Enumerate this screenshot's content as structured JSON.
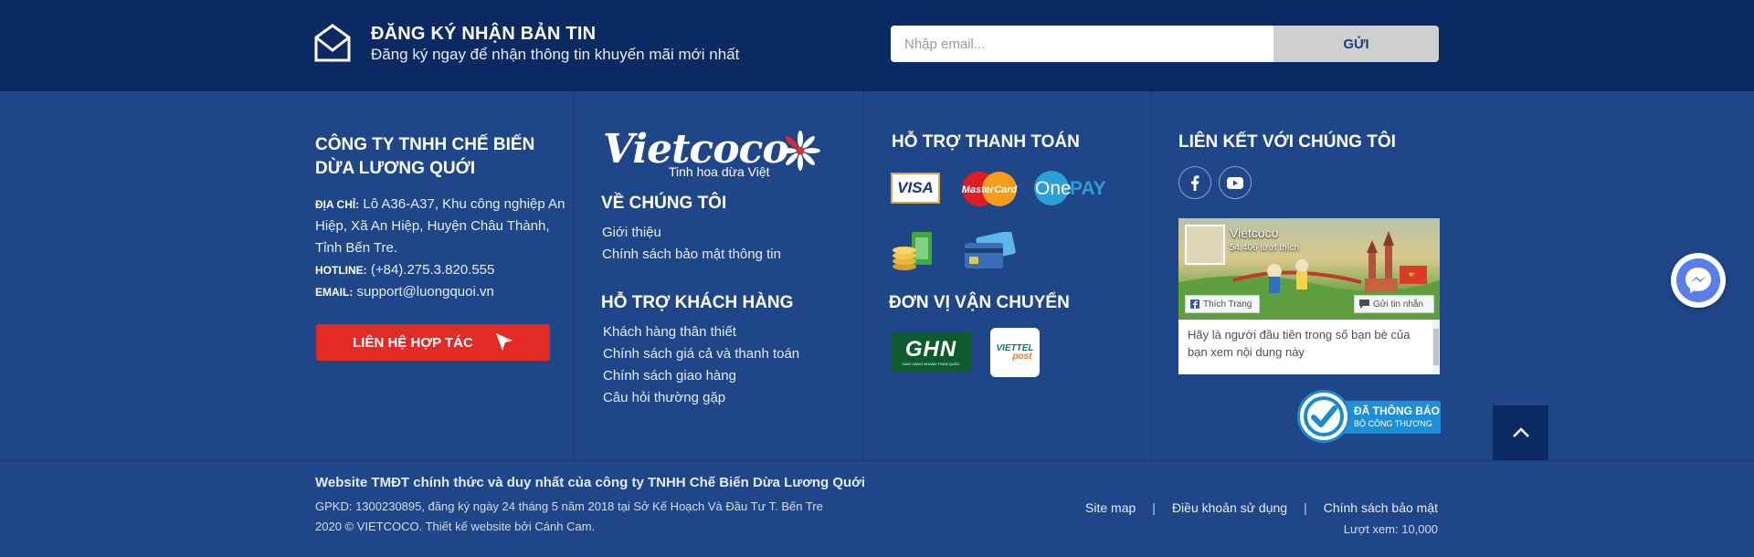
{
  "newsletter": {
    "title": "ĐĂNG KÝ NHẬN BẢN TIN",
    "subtitle": "Đăng ký ngay để nhận thông tin khuyến mãi mới nhất",
    "placeholder": "Nhập email...",
    "button": "GỬI"
  },
  "company": {
    "name": "CÔNG TY TNHH CHẾ BIẾN DỪA LƯƠNG QUỚI",
    "address_label": "ĐỊA CHỈ:",
    "address": "Lô A36-A37, Khu công nghiệp An Hiệp, Xã An Hiệp, Huyện Châu Thành, Tỉnh Bến Tre.",
    "hotline_label": "HOTLINE:",
    "hotline": "(+84).275.3.820.555",
    "email_label": "EMAIL:",
    "email": "support@luongquoi.vn",
    "contact_button": "LIÊN HỆ HỢP TÁC"
  },
  "brand": {
    "logo": "Vietcoco",
    "tagline": "Tinh hoa dừa Việt"
  },
  "about": {
    "title": "VỀ CHÚNG TÔI",
    "links": [
      "Giới thiệu",
      "Chính sách bảo mật thông tin"
    ]
  },
  "support": {
    "title": "HỖ TRỢ KHÁCH HÀNG",
    "links": [
      "Khách hàng thân thiết",
      "Chính sách giá cả và thanh toán",
      "Chính sách giao hàng",
      "Câu hỏi thường gặp"
    ]
  },
  "payment": {
    "title": "HỖ TRỢ THANH TOÁN",
    "visa": "VISA",
    "mastercard": "MasterCard",
    "onepay_one": "One",
    "onepay_pay": "PAY"
  },
  "shipping": {
    "title": "ĐƠN VỊ VẬN CHUYỂN",
    "ghn": "GHN",
    "ghn_sub": "GIAO HÀNG NHANH TOÀN QUỐC",
    "viettel_1": "VIETTEL",
    "viettel_2": "post"
  },
  "connect": {
    "title": "LIÊN KẾT VỚI CHÚNG TÔI"
  },
  "fb": {
    "page_name": "Vietcoco",
    "likes": "54.406 lượt thích",
    "like_button": "Thích Trang",
    "message_button": "Gửi tin nhắn",
    "text": "Hãy là người đầu tiên trong số bạn bè của bạn xem nội dung này"
  },
  "badge": {
    "line1": "ĐÃ THÔNG BÁO",
    "line2": "BỘ CÔNG THƯƠNG"
  },
  "bottom": {
    "title": "Website TMĐT chính thức và duy nhất của công ty TNHH Chế Biến Dừa Lương Quới",
    "line1": "GPKD: 1300230895, đăng ký ngày 24 tháng 5 năm 2018 tại Sở Kế Hoạch Và Đầu Tư T. Bến Tre",
    "line2": "2020 © VIETCOCO. Thiết kế website bởi Cánh Cam.",
    "links": [
      "Site map",
      "Điều khoản sử dụng",
      "Chính sách bảo mật"
    ],
    "separator": "|",
    "views": "Lượt xem: 10,000"
  },
  "colors": {
    "footer_bg": "#1f4689",
    "newsletter_bg": "#0b2a63",
    "accent_red": "#e02b26"
  }
}
